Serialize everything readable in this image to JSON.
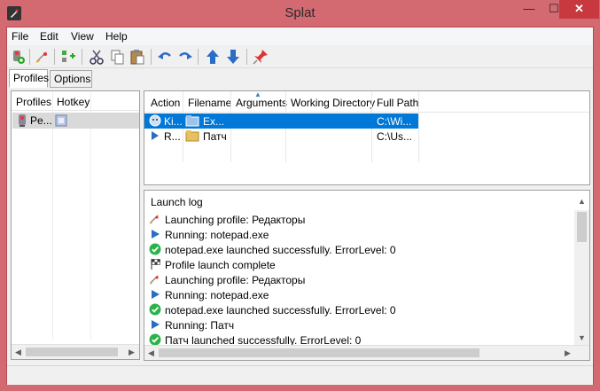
{
  "window": {
    "title": "Splat"
  },
  "titlebar": {
    "minimize": "—",
    "maximize": "☐",
    "close": "✕"
  },
  "menu": [
    "File",
    "Edit",
    "View",
    "Help"
  ],
  "tabs": [
    "Profiles",
    "Options"
  ],
  "profiles_list": {
    "columns": [
      "Profiles",
      "Hotkey"
    ],
    "rows": [
      {
        "name": "Pe..."
      }
    ]
  },
  "grid": {
    "columns": [
      "Action",
      "Filename",
      "Arguments",
      "Working Directory",
      "Full Path"
    ],
    "rows": [
      {
        "action": "Ki...",
        "filename": "Ex...",
        "arguments": "",
        "working_dir": "",
        "full_path": "C:\\Wi...",
        "selected": true
      },
      {
        "action": "R...",
        "filename": "Патч",
        "arguments": "",
        "working_dir": "",
        "full_path": "C:\\Us...",
        "selected": false
      }
    ]
  },
  "log": {
    "title": "Launch log",
    "lines": [
      {
        "icon": "rocket-icon",
        "text": "Launching profile: Редакторы"
      },
      {
        "icon": "play-icon",
        "text": "Running: notepad.exe"
      },
      {
        "icon": "check-icon",
        "text": "notepad.exe launched successfully.  ErrorLevel: 0"
      },
      {
        "icon": "flag-icon",
        "text": "Profile launch complete"
      },
      {
        "icon": "rocket-icon",
        "text": "Launching profile: Редакторы"
      },
      {
        "icon": "play-icon",
        "text": "Running: notepad.exe"
      },
      {
        "icon": "check-icon",
        "text": "notepad.exe launched successfully.  ErrorLevel: 0"
      },
      {
        "icon": "play-icon",
        "text": "Running: Патч"
      },
      {
        "icon": "check-icon",
        "text": "Патч launched successfully.  ErrorLevel: 0"
      }
    ]
  },
  "colors": {
    "accent": "#0078d7",
    "title_bg": "#d36a72",
    "close_bg": "#c7383f"
  }
}
